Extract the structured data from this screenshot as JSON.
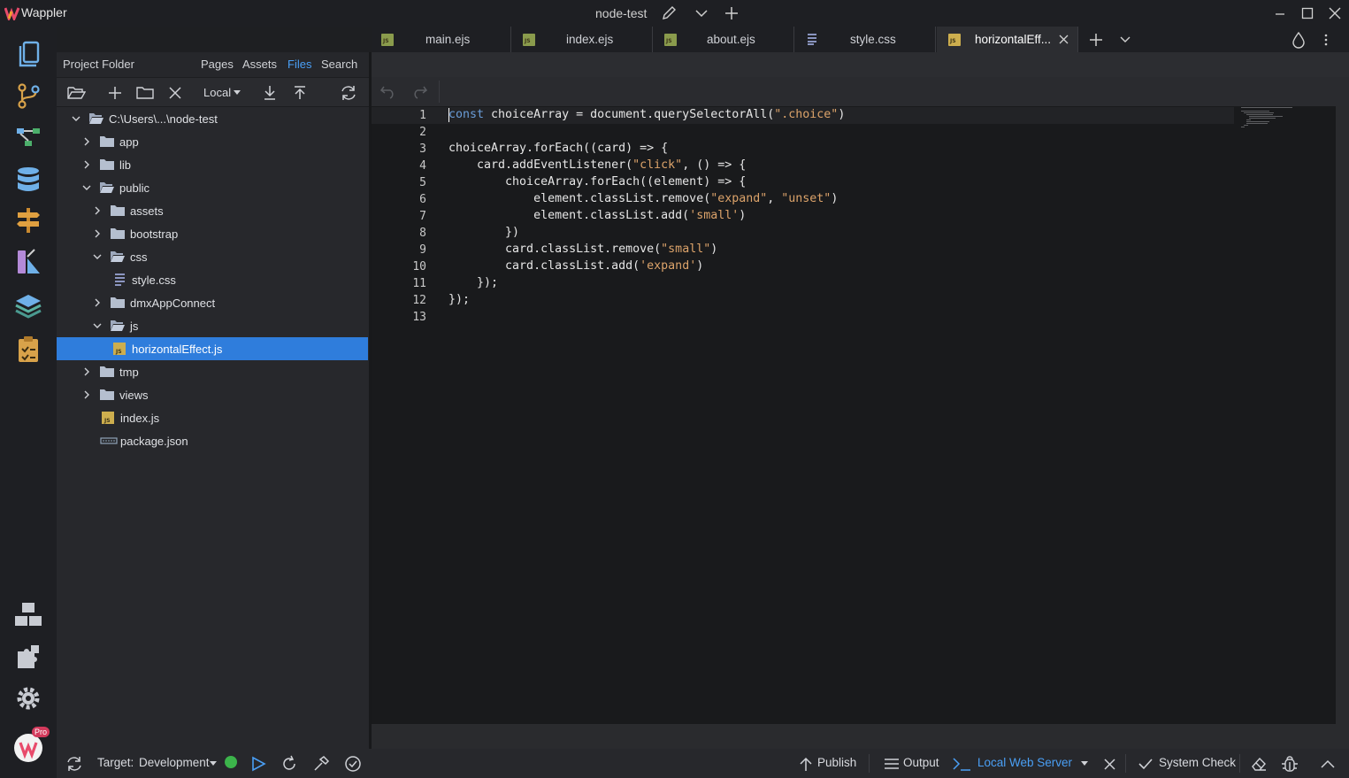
{
  "app": {
    "name": "Wappler",
    "project_title": "node-test"
  },
  "tabs": [
    {
      "label": "main.ejs",
      "icon": "ejs-file-icon",
      "active": false
    },
    {
      "label": "index.ejs",
      "icon": "ejs-file-icon",
      "active": false
    },
    {
      "label": "about.ejs",
      "icon": "ejs-file-icon",
      "active": false
    },
    {
      "label": "style.css",
      "icon": "css-file-icon",
      "active": false
    },
    {
      "label": "horizontalEff...",
      "icon": "js-file-icon",
      "active": true
    }
  ],
  "panel": {
    "title": "Project Folder",
    "tabs": [
      "Pages",
      "Assets",
      "Files",
      "Search"
    ],
    "active_tab": "Files",
    "target_select": "Local"
  },
  "tree": [
    {
      "label": "C:\\Users\\...\\node-test",
      "type": "folder",
      "expanded": true,
      "depth": 0
    },
    {
      "label": "app",
      "type": "folder",
      "expanded": false,
      "depth": 1
    },
    {
      "label": "lib",
      "type": "folder",
      "expanded": false,
      "depth": 1
    },
    {
      "label": "public",
      "type": "folder",
      "expanded": true,
      "depth": 1
    },
    {
      "label": "assets",
      "type": "folder",
      "expanded": false,
      "depth": 2
    },
    {
      "label": "bootstrap",
      "type": "folder",
      "expanded": false,
      "depth": 2
    },
    {
      "label": "css",
      "type": "folder",
      "expanded": true,
      "depth": 2
    },
    {
      "label": "style.css",
      "type": "css",
      "depth": 3
    },
    {
      "label": "dmxAppConnect",
      "type": "folder",
      "expanded": false,
      "depth": 2
    },
    {
      "label": "js",
      "type": "folder",
      "expanded": true,
      "depth": 2
    },
    {
      "label": "horizontalEffect.js",
      "type": "js",
      "depth": 3,
      "selected": true
    },
    {
      "label": "tmp",
      "type": "folder",
      "expanded": false,
      "depth": 1
    },
    {
      "label": "views",
      "type": "folder",
      "expanded": false,
      "depth": 1
    },
    {
      "label": "index.js",
      "type": "js",
      "depth": 1
    },
    {
      "label": "package.json",
      "type": "json",
      "depth": 1
    }
  ],
  "editor": {
    "line_numbers": [
      "1",
      "2",
      "3",
      "4",
      "5",
      "6",
      "7",
      "8",
      "9",
      "10",
      "11",
      "12",
      "13"
    ],
    "lines": [
      [
        {
          "t": "const",
          "c": "kw"
        },
        {
          "t": " choiceArray = document.querySelectorAll("
        },
        {
          "t": "\".choice\"",
          "c": "str"
        },
        {
          "t": ")"
        }
      ],
      [],
      [
        {
          "t": "choiceArray.forEach((card) => {"
        }
      ],
      [
        {
          "t": "    card.addEventListener("
        },
        {
          "t": "\"click\"",
          "c": "str"
        },
        {
          "t": ", () => {"
        }
      ],
      [
        {
          "t": "        choiceArray.forEach((element) => {"
        }
      ],
      [
        {
          "t": "            element.classList.remove("
        },
        {
          "t": "\"expand\"",
          "c": "str"
        },
        {
          "t": ", "
        },
        {
          "t": "\"unset\"",
          "c": "str"
        },
        {
          "t": ")"
        }
      ],
      [
        {
          "t": "            element.classList.add("
        },
        {
          "t": "'small'",
          "c": "str"
        },
        {
          "t": ")"
        }
      ],
      [
        {
          "t": "        })"
        }
      ],
      [
        {
          "t": "        card.classList.remove("
        },
        {
          "t": "\"small\"",
          "c": "str"
        },
        {
          "t": ")"
        }
      ],
      [
        {
          "t": "        card.classList.add("
        },
        {
          "t": "'expand'",
          "c": "str"
        },
        {
          "t": ")"
        }
      ],
      [
        {
          "t": "    });"
        }
      ],
      [
        {
          "t": "});"
        }
      ],
      []
    ]
  },
  "status": {
    "target_label": "Target:",
    "target_value": "Development",
    "server_status_color": "#3cb44b",
    "publish": "Publish",
    "output": "Output",
    "local_web_server": "Local Web Server",
    "system_check": "System Check",
    "pro_badge": "Pro"
  },
  "colors": {
    "accent": "#2f7ddc",
    "link_blue": "#4a9ff5",
    "keyword": "#6a9dd8",
    "string": "#dca36a"
  }
}
